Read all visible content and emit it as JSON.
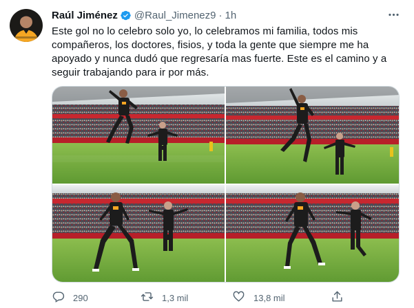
{
  "tweet": {
    "author": {
      "display_name": "Raúl Jiménez",
      "handle": "@Raul_Jimenez9",
      "verified": true
    },
    "separator": "·",
    "time": "1h",
    "text": "Este gol no lo celebro solo yo, lo celebramos mi familia, todos mis compañeros, los doctores, fisios, y toda la gente que siempre me ha apoyado y nunca dudó que regresaría mas fuerte. Este es el camino y a seguir trabajando para ir por más.",
    "media_count": 4
  },
  "actions": {
    "reply_count": "290",
    "retweet_count": "1,3 mil",
    "like_count": "13,8 mil"
  },
  "colors": {
    "accent": "#1d9bf0",
    "secondary_text": "#536471",
    "primary_text": "#0f1419",
    "border": "#cfd9de",
    "kit_gold": "#f5a623",
    "kit_black": "#1c1c1c",
    "pitch_green": "#6aa33a"
  },
  "icons": {
    "verified": "verified-badge-icon",
    "more": "more-options-icon",
    "reply": "reply-icon",
    "retweet": "retweet-icon",
    "like": "heart-icon",
    "share": "share-icon"
  }
}
